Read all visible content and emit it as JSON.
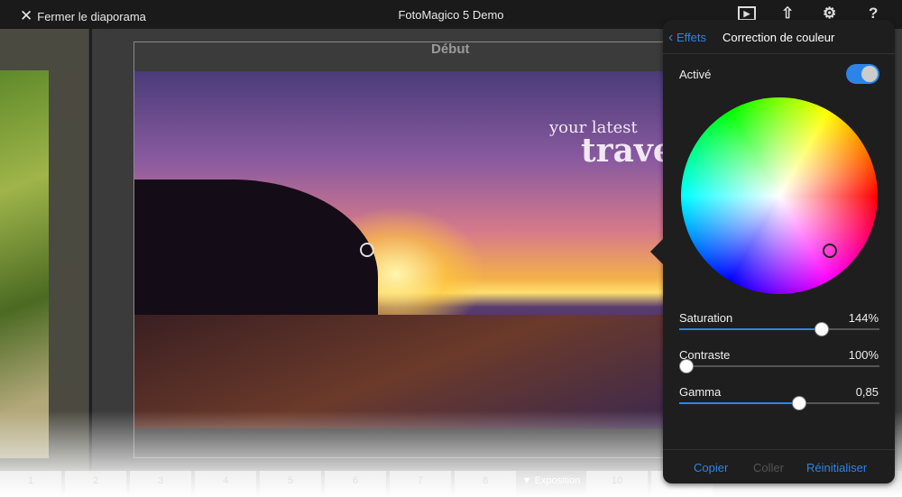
{
  "topbar": {
    "close_label": "Fermer le diaporama",
    "title": "FotoMagico 5 Demo",
    "icons": [
      "play-preview-icon",
      "share-icon",
      "gear-icon",
      "help-icon"
    ],
    "help_glyph": "?"
  },
  "canvas": {
    "slide_label": "Début",
    "tagline_line1": "your latest",
    "tagline_line2": "trave"
  },
  "timeline": {
    "items": [
      "1",
      "2",
      "3",
      "4",
      "5",
      "6",
      "7",
      "8",
      "▼ Exposition",
      "10",
      "11"
    ]
  },
  "popover": {
    "back_label": "Effets",
    "title": "Correction de couleur",
    "active_label": "Activé",
    "active": true,
    "color_wheel_knob": "near center, slightly toward red/orange",
    "sliders": [
      {
        "label": "Saturation",
        "value": "144%",
        "fraction": 0.71
      },
      {
        "label": "Contraste",
        "value": "100%",
        "fraction": 0.03
      },
      {
        "label": "Gamma",
        "value": "0,85",
        "fraction": 0.6
      }
    ],
    "buttons": {
      "copy": "Copier",
      "paste": "Coller",
      "reset": "Réinitialiser"
    },
    "accent": "#2c84e8"
  }
}
